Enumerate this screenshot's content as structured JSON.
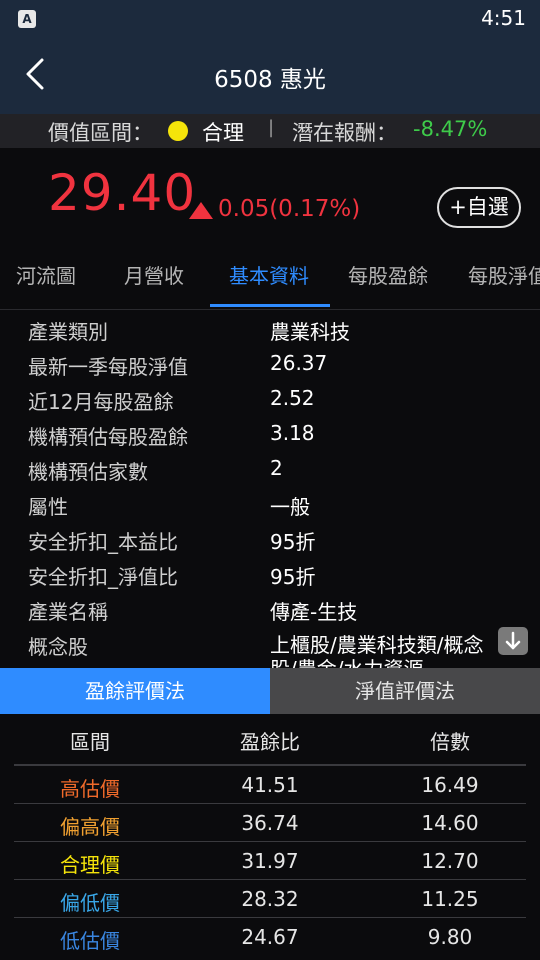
{
  "status_bar": {
    "app_icon": "A",
    "time": "4:51"
  },
  "header": {
    "title": "6508 惠光"
  },
  "value_bar": {
    "label": "價值區間：",
    "status_dot_color": "#f5e40a",
    "status": "合理",
    "separator": "|",
    "return_label": "潛在報酬：",
    "return_value": "-8.47%"
  },
  "quote": {
    "price": "29.40",
    "change": "0.05(0.17%)",
    "watch_label": "+自選"
  },
  "tabs": [
    {
      "label": "河流圖"
    },
    {
      "label": "月營收"
    },
    {
      "label": "基本資料"
    },
    {
      "label": "每股盈餘"
    },
    {
      "label": "每股淨值"
    }
  ],
  "info": [
    {
      "label": "產業類別",
      "value": "農業科技"
    },
    {
      "label": "最新一季每股淨值",
      "value": "26.37"
    },
    {
      "label": "近12月每股盈餘",
      "value": "2.52"
    },
    {
      "label": "機構預估每股盈餘",
      "value": "3.18"
    },
    {
      "label": "機構預估家數",
      "value": "2"
    },
    {
      "label": "屬性",
      "value": "一般"
    },
    {
      "label": "安全折扣_本益比",
      "value": "95折"
    },
    {
      "label": "安全折扣_淨值比",
      "value": "95折"
    },
    {
      "label": "產業名稱",
      "value": "傳產-生技"
    },
    {
      "label": "概念股",
      "value": "上櫃股/農業科技類/概念股/農金/水力資源"
    }
  ],
  "valuation_tabs": {
    "eps_method": "盈餘評價法",
    "nav_method": "淨值評價法"
  },
  "table": {
    "headers": [
      "區間",
      "盈餘比",
      "倍數"
    ],
    "rows": [
      {
        "zone": "高估價",
        "ratio": "41.51",
        "multiple": "16.49",
        "color": "#f06a2a"
      },
      {
        "zone": "偏高價",
        "ratio": "36.74",
        "multiple": "14.60",
        "color": "#f0a030"
      },
      {
        "zone": "合理價",
        "ratio": "31.97",
        "multiple": "12.70",
        "color": "#f5e40a"
      },
      {
        "zone": "偏低價",
        "ratio": "28.32",
        "multiple": "11.25",
        "color": "#39a7e8"
      },
      {
        "zone": "低估價",
        "ratio": "24.67",
        "multiple": "9.80",
        "color": "#3a86e0"
      }
    ]
  }
}
